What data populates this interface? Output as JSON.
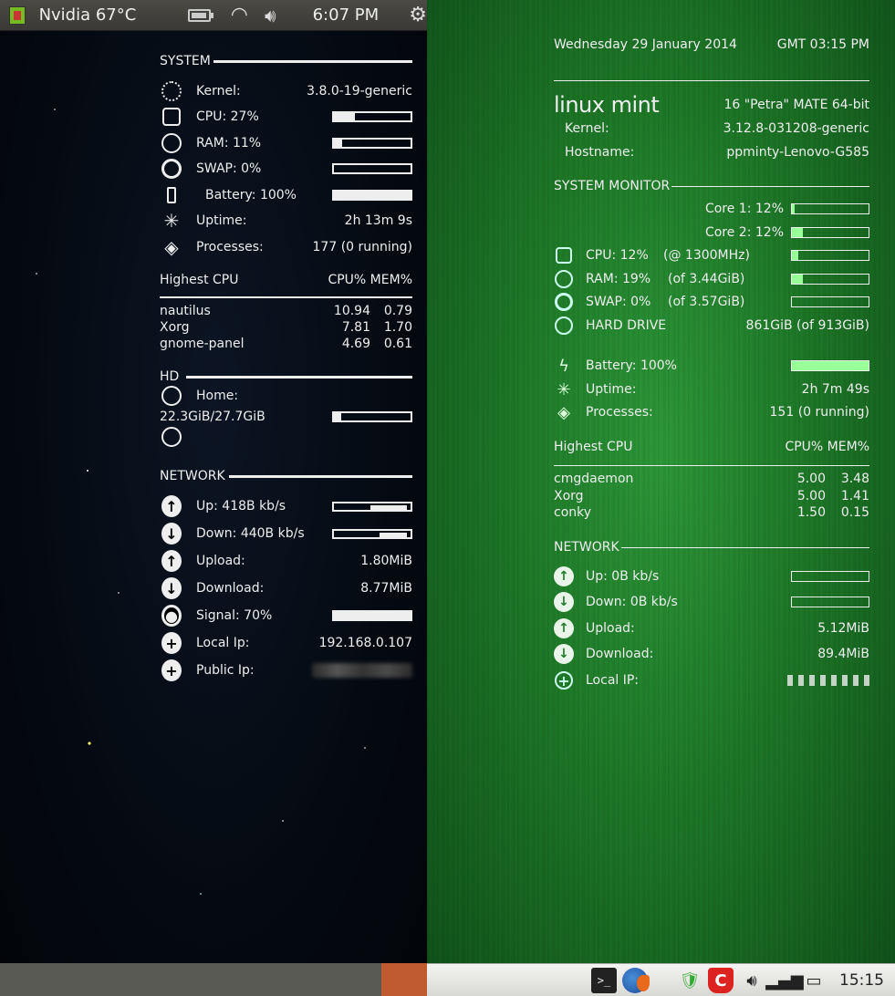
{
  "left": {
    "topbar": {
      "nvidia_text": "Nvidia 67°C",
      "clock": "6:07 PM",
      "icons": [
        "nvidia-icon",
        "battery-icon",
        "wifi-icon",
        "volume-icon",
        "gear-icon"
      ]
    },
    "system": {
      "heading": "SYSTEM",
      "kernel_label": "Kernel:",
      "kernel_value": "3.8.0-19-generic",
      "cpu_label": "CPU: 27%",
      "cpu_level": 0.27,
      "ram_label": "RAM: 11%",
      "ram_level": 0.11,
      "swap_label": "SWAP: 0%",
      "swap_level": 0,
      "battery_label": "Battery: 100%",
      "battery_level": 1.0,
      "uptime_label": "Uptime:",
      "uptime_value": "2h 13m 9s",
      "processes_label": "Processes:",
      "processes_value": "177 (0 running)"
    },
    "highest_cpu": {
      "heading": "Highest CPU",
      "columns": "CPU% MEM%",
      "rows": [
        {
          "name": "nautilus",
          "cpu": "10.94",
          "mem": "0.79"
        },
        {
          "name": "Xorg",
          "cpu": "7.81",
          "mem": "1.70"
        },
        {
          "name": "gnome-panel",
          "cpu": "4.69",
          "mem": "0.61"
        }
      ]
    },
    "hd": {
      "heading": "HD",
      "home_label": "Home:",
      "usage": "22.3GiB/27.7GiB",
      "usage_level": 0.1
    },
    "network": {
      "heading": "NETWORK",
      "up_label": "Up: 418B  kb/s",
      "down_label": "Down: 440B  kb/s",
      "upload_label": "Upload:",
      "upload_value": "1.80MiB",
      "download_label": "Download:",
      "download_value": "8.77MiB",
      "signal_label": "Signal: 70%",
      "signal_level": 1.0,
      "localip_label": "Local Ip:",
      "localip_value": "192.168.0.107",
      "publicip_label": "Public Ip:"
    }
  },
  "right": {
    "date": "Wednesday 29 January 2014",
    "time": "GMT 03:15 PM",
    "logo": "linux mint",
    "release": "16 \"Petra\" MATE 64-bit",
    "kernel_label": "Kernel:",
    "kernel_value": "3.12.8-031208-generic",
    "hostname_label": "Hostname:",
    "hostname_value": "ppminty-Lenovo-G585",
    "sysmon": {
      "heading": "SYSTEM MONITOR",
      "core1": "Core 1: 12%",
      "core1_level": 0.04,
      "core2": "Core 2: 12%",
      "core2_level": 0.14,
      "cpu_label": "CPU: 12%",
      "cpu_freq": "(@ 1300MHz)",
      "cpu_level": 0.08,
      "ram_label": "RAM: 19%",
      "ram_of": "(of 3.44GiB)",
      "ram_level": 0.14,
      "swap_label": "SWAP: 0%",
      "swap_of": "(of 3.57GiB)",
      "swap_level": 0,
      "hdd_label": "HARD DRIVE",
      "hdd_value": "861GiB (of 913GiB)",
      "battery_label": "Battery: 100%",
      "battery_level": 1.0,
      "uptime_label": "Uptime:",
      "uptime_value": "2h 7m 49s",
      "processes_label": "Processes:",
      "processes_value": "151 (0 running)"
    },
    "highest_cpu": {
      "heading": "Highest CPU",
      "columns": "CPU% MEM%",
      "rows": [
        {
          "name": "cmgdaemon",
          "cpu": "5.00",
          "mem": "3.48"
        },
        {
          "name": "Xorg",
          "cpu": "5.00",
          "mem": "1.41"
        },
        {
          "name": "conky",
          "cpu": "1.50",
          "mem": "0.15"
        }
      ]
    },
    "network": {
      "heading": "NETWORK",
      "up_label": "Up: 0B  kb/s",
      "down_label": "Down: 0B  kb/s",
      "upload_label": "Upload:",
      "upload_value": "5.12MiB",
      "download_label": "Download:",
      "download_value": "89.4MiB",
      "localip_label": "Local IP:"
    },
    "taskbar": {
      "clock": "15:15",
      "icons": [
        "terminal-icon",
        "firefox-icon",
        "shield-icon",
        "comodo-icon",
        "volume-icon",
        "signal-icon",
        "battery-icon"
      ]
    }
  }
}
